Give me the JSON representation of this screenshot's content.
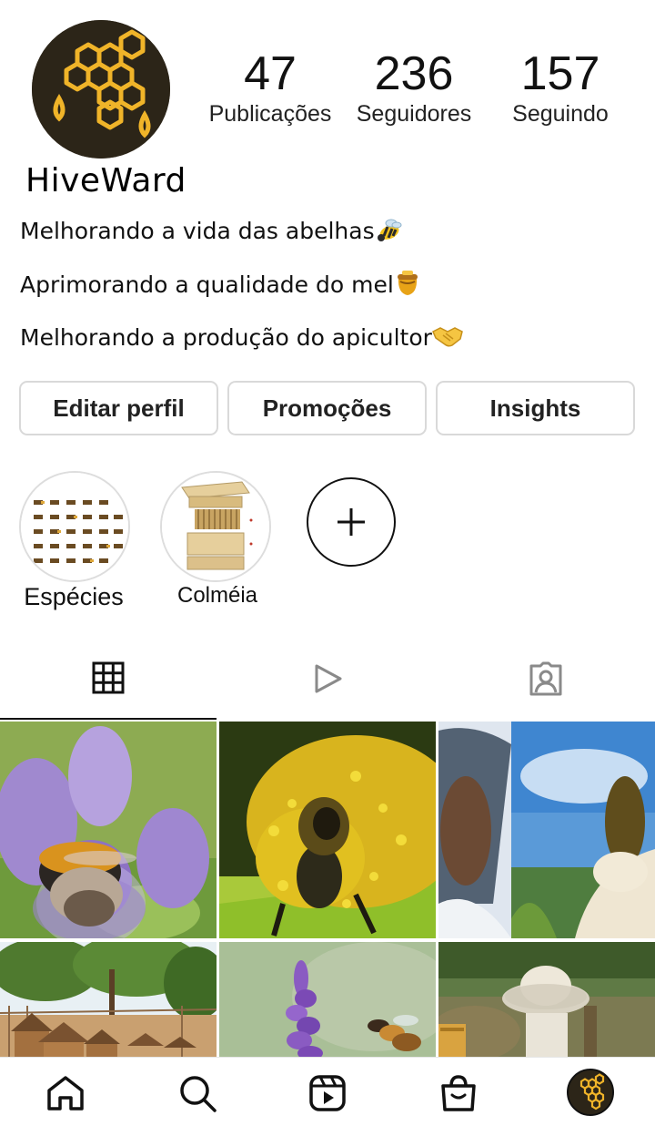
{
  "profile": {
    "username": "HiveWard",
    "avatar_icon": "honeycomb-logo",
    "brand_color": "#f0b429",
    "stats": {
      "posts_count": "47",
      "posts_label": "Publicações",
      "followers_count": "236",
      "followers_label": "Seguidores",
      "following_count": "157",
      "following_label": "Seguindo"
    },
    "bio": [
      {
        "text": "Melhorando a vida das abelhas",
        "emoji": "bee-emoji"
      },
      {
        "text": "Aprimorando a qualidade do mel",
        "emoji": "honey-pot-emoji"
      },
      {
        "text": "Melhorando a produção do apicultor",
        "emoji": "handshake-emoji"
      }
    ]
  },
  "buttons": {
    "edit_profile": "Editar perfil",
    "promotions": "Promoções",
    "insights": "Insights"
  },
  "highlights": [
    {
      "label": "Espécies",
      "icon": "bee-species-chart-thumbnail"
    },
    {
      "label": "Colméia",
      "icon": "beehive-boxes-thumbnail"
    },
    {
      "label": "",
      "icon": "plus-icon"
    }
  ],
  "tabs": [
    {
      "name": "posts-grid",
      "icon": "grid-icon",
      "active": true
    },
    {
      "name": "reels",
      "icon": "play-icon",
      "active": false
    },
    {
      "name": "tagged",
      "icon": "tagged-person-icon",
      "active": false
    }
  ],
  "grid_posts": [
    {
      "subject": "bumblebee-on-purple-flower"
    },
    {
      "subject": "bee-covered-in-pollen-closeup"
    },
    {
      "subject": "beekeeper-holding-bee-swarm"
    },
    {
      "subject": "wooden-beehives-under-trees"
    },
    {
      "subject": "bee-near-lavender"
    },
    {
      "subject": "beekeeper-with-veil-hat"
    }
  ],
  "bottom_nav": [
    {
      "name": "home",
      "icon": "home-icon"
    },
    {
      "name": "search",
      "icon": "search-icon"
    },
    {
      "name": "reels",
      "icon": "reels-icon"
    },
    {
      "name": "shop",
      "icon": "shopping-bag-icon"
    },
    {
      "name": "profile",
      "icon": "profile-avatar-icon"
    }
  ]
}
